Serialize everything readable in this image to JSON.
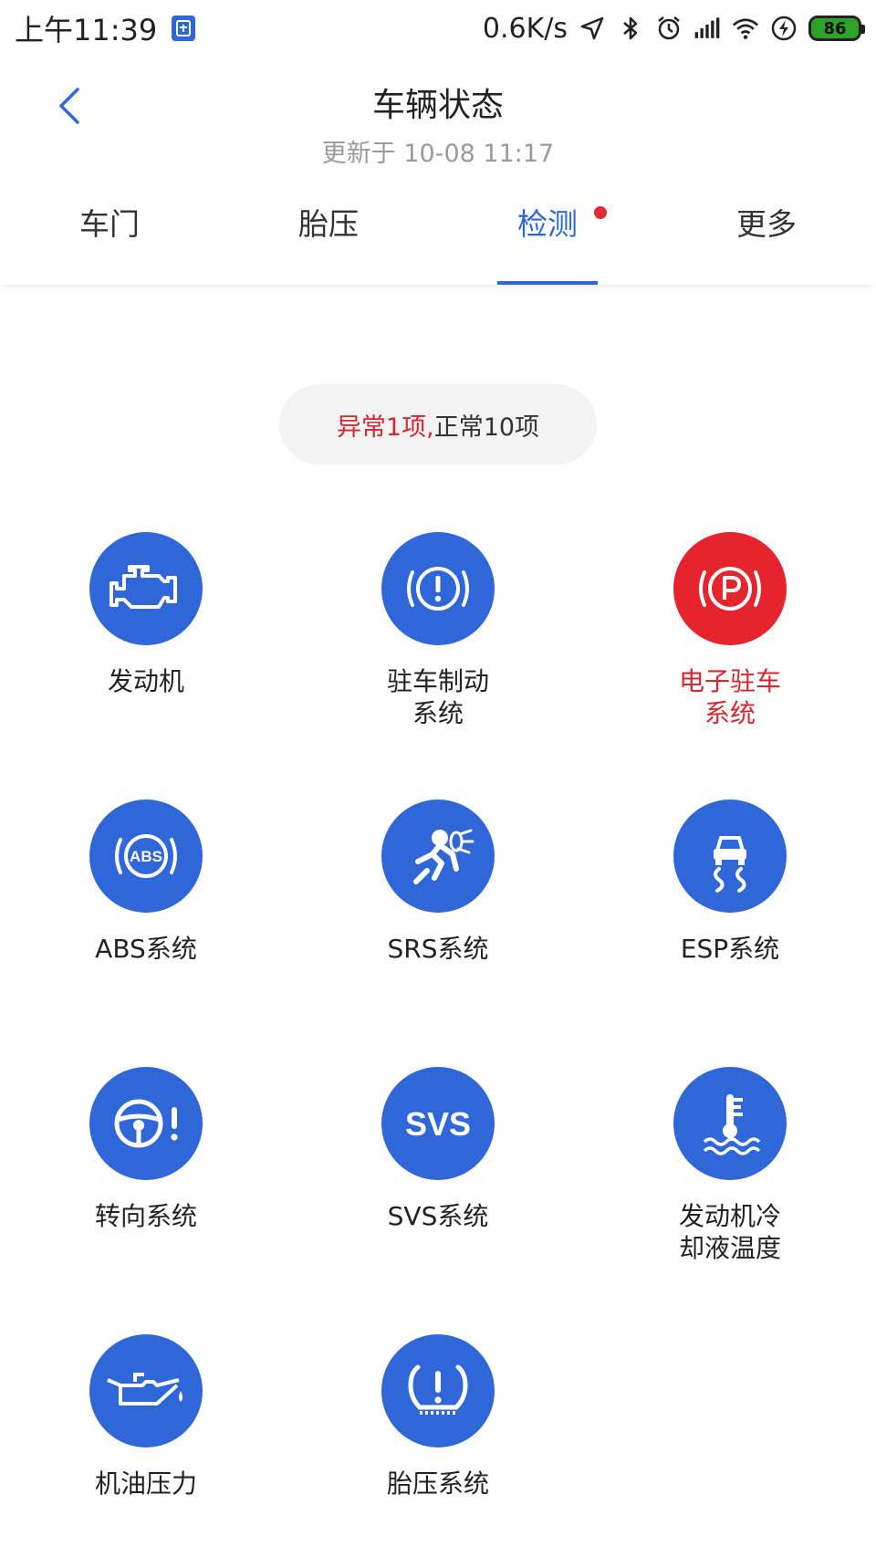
{
  "status_bar": {
    "time": "上午11:39",
    "net_speed": "0.6K/s",
    "battery": "86",
    "icons": [
      "app-notification-icon",
      "location-arrow-icon",
      "bluetooth-icon",
      "alarm-icon",
      "signal-icon",
      "wifi-icon",
      "charging-icon",
      "battery-icon"
    ]
  },
  "header": {
    "title": "车辆状态",
    "subtitle": "更新于 10-08 11:17"
  },
  "tabs": [
    {
      "label": "车门"
    },
    {
      "label": "胎压"
    },
    {
      "label": "检测",
      "active": true,
      "badge": true
    },
    {
      "label": "更多"
    }
  ],
  "summary": {
    "abnormal": "异常1项,",
    "normal": "正常10项"
  },
  "colors": {
    "accent": "#2f66d8",
    "alert": "#e5242d",
    "alert_text": "#d8262e"
  },
  "items": [
    {
      "label": "发动机",
      "icon": "engine-icon",
      "status": "normal"
    },
    {
      "label": "驻车制动系统",
      "icon": "brake-warning-icon",
      "status": "normal"
    },
    {
      "label": "电子驻车系统",
      "icon": "parking-brake-icon",
      "status": "abnormal"
    },
    {
      "label": "ABS系统",
      "icon": "abs-icon",
      "status": "normal"
    },
    {
      "label": "SRS系统",
      "icon": "airbag-icon",
      "status": "normal"
    },
    {
      "label": "ESP系统",
      "icon": "esp-skid-icon",
      "status": "normal"
    },
    {
      "label": "转向系统",
      "icon": "steering-wheel-icon",
      "status": "normal"
    },
    {
      "label": "SVS系统",
      "icon": "svs-icon",
      "status": "normal",
      "icon_text": "SVS"
    },
    {
      "label": "发动机冷却液温度",
      "icon": "coolant-temperature-icon",
      "status": "normal"
    },
    {
      "label": "机油压力",
      "icon": "oil-pressure-icon",
      "status": "normal"
    },
    {
      "label": "胎压系统",
      "icon": "tire-pressure-icon",
      "status": "normal"
    }
  ]
}
